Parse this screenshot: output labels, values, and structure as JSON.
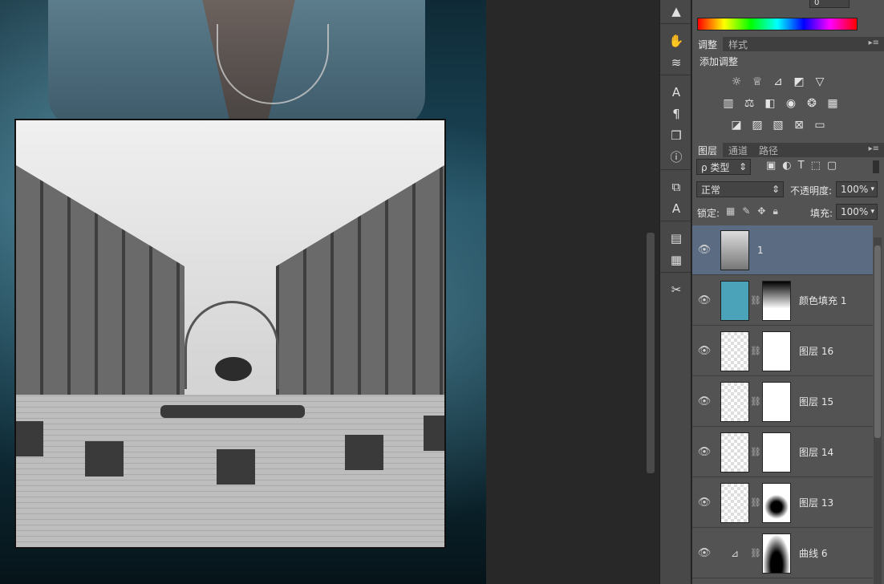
{
  "canvas": {},
  "color_panel": {
    "top_value": "0"
  },
  "adjust_panel": {
    "tabs": [
      {
        "label": "调整"
      },
      {
        "label": "样式"
      }
    ],
    "heading": "添加调整"
  },
  "layers_panel": {
    "tabs": [
      {
        "label": "图层"
      },
      {
        "label": "通道"
      },
      {
        "label": "路径"
      }
    ],
    "filter_label": "ρ 类型",
    "blend_mode": "正常",
    "opacity_label": "不透明度:",
    "opacity_value": "100%",
    "lock_label": "锁定:",
    "fill_label": "填充:",
    "fill_value": "100%",
    "layers": [
      {
        "name": "1",
        "selected": true
      },
      {
        "name": "颜色填充 1"
      },
      {
        "name": "图层 16"
      },
      {
        "name": "图层 15"
      },
      {
        "name": "图层 14"
      },
      {
        "name": "图层 13"
      },
      {
        "name": "曲线 6"
      }
    ]
  },
  "colors": {
    "accent": "#5b6b82",
    "fill_swatch": "#4aa3b8"
  }
}
